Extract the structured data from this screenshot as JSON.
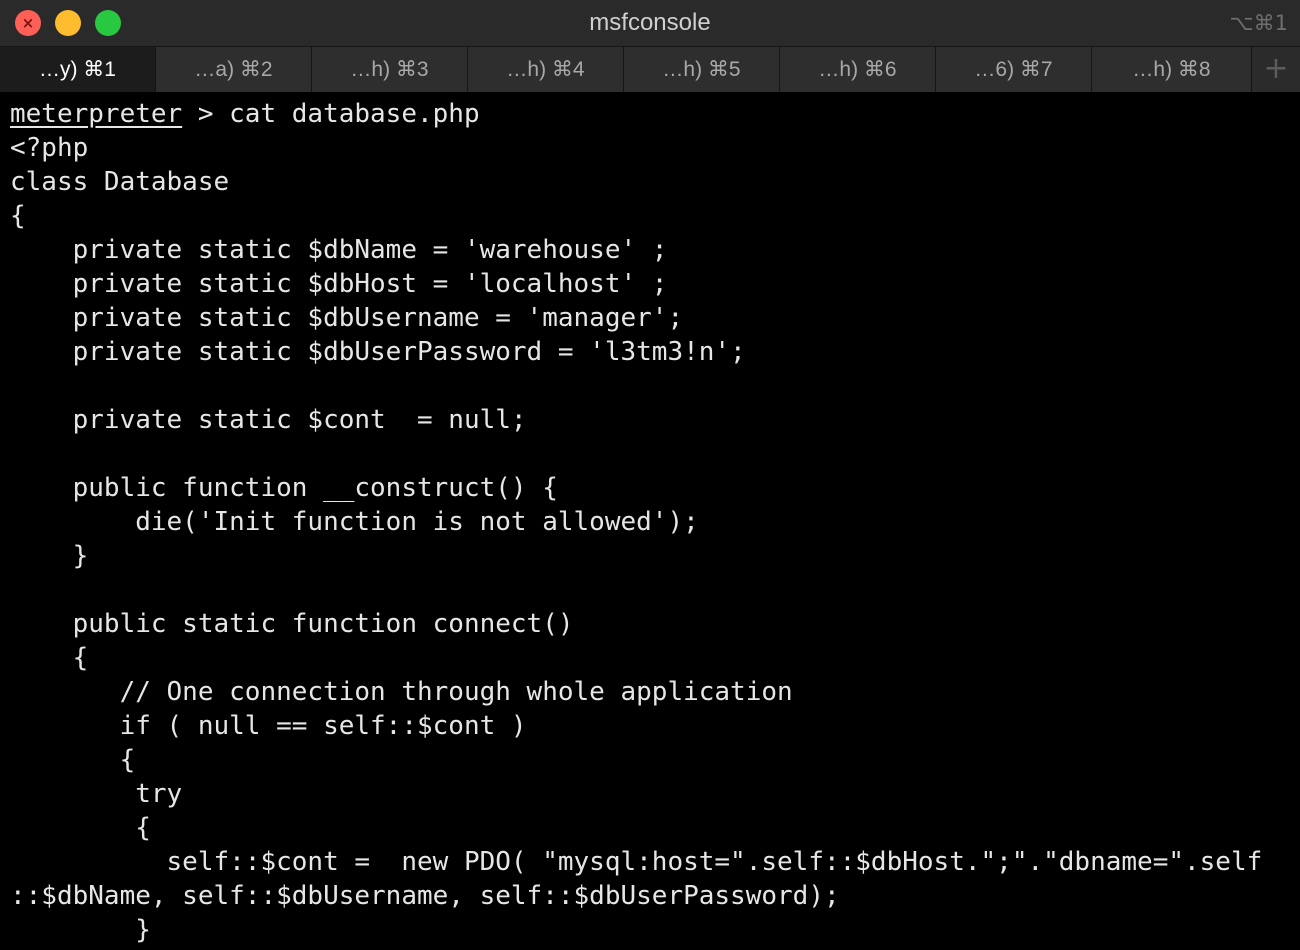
{
  "window": {
    "title": "msfconsole",
    "shortcut": "⌥⌘1",
    "traffic_close_glyph": "×"
  },
  "tabs": [
    {
      "label": "…y)  ⌘1",
      "active": true
    },
    {
      "label": "…a)  ⌘2",
      "active": false
    },
    {
      "label": "…h)  ⌘3",
      "active": false
    },
    {
      "label": "…h)  ⌘4",
      "active": false
    },
    {
      "label": "…h)  ⌘5",
      "active": false
    },
    {
      "label": "…h)  ⌘6",
      "active": false
    },
    {
      "label": "…6)  ⌘7",
      "active": false
    },
    {
      "label": "…h)  ⌘8",
      "active": false
    }
  ],
  "new_tab_glyph": "+",
  "terminal": {
    "prompt": "meterpreter",
    "command": " > cat database.php",
    "lines": [
      "<?php",
      "class Database",
      "{",
      "    private static $dbName = 'warehouse' ;",
      "    private static $dbHost = 'localhost' ;",
      "    private static $dbUsername = 'manager';",
      "    private static $dbUserPassword = 'l3tm3!n';",
      "",
      "    private static $cont  = null;",
      "",
      "    public function __construct() {",
      "        die('Init function is not allowed');",
      "    }",
      "",
      "    public static function connect()",
      "    {",
      "       // One connection through whole application",
      "       if ( null == self::$cont )",
      "       {",
      "        try",
      "        {",
      "          self::$cont =  new PDO( \"mysql:host=\".self::$dbHost.\";\".\"dbname=\".self",
      "::$dbName, self::$dbUsername, self::$dbUserPassword);",
      "        }"
    ]
  },
  "colors": {
    "background": "#000000",
    "text": "#e6e6e6",
    "close": "#fe5f57",
    "minimize": "#febc2e",
    "maximize": "#28c840"
  }
}
